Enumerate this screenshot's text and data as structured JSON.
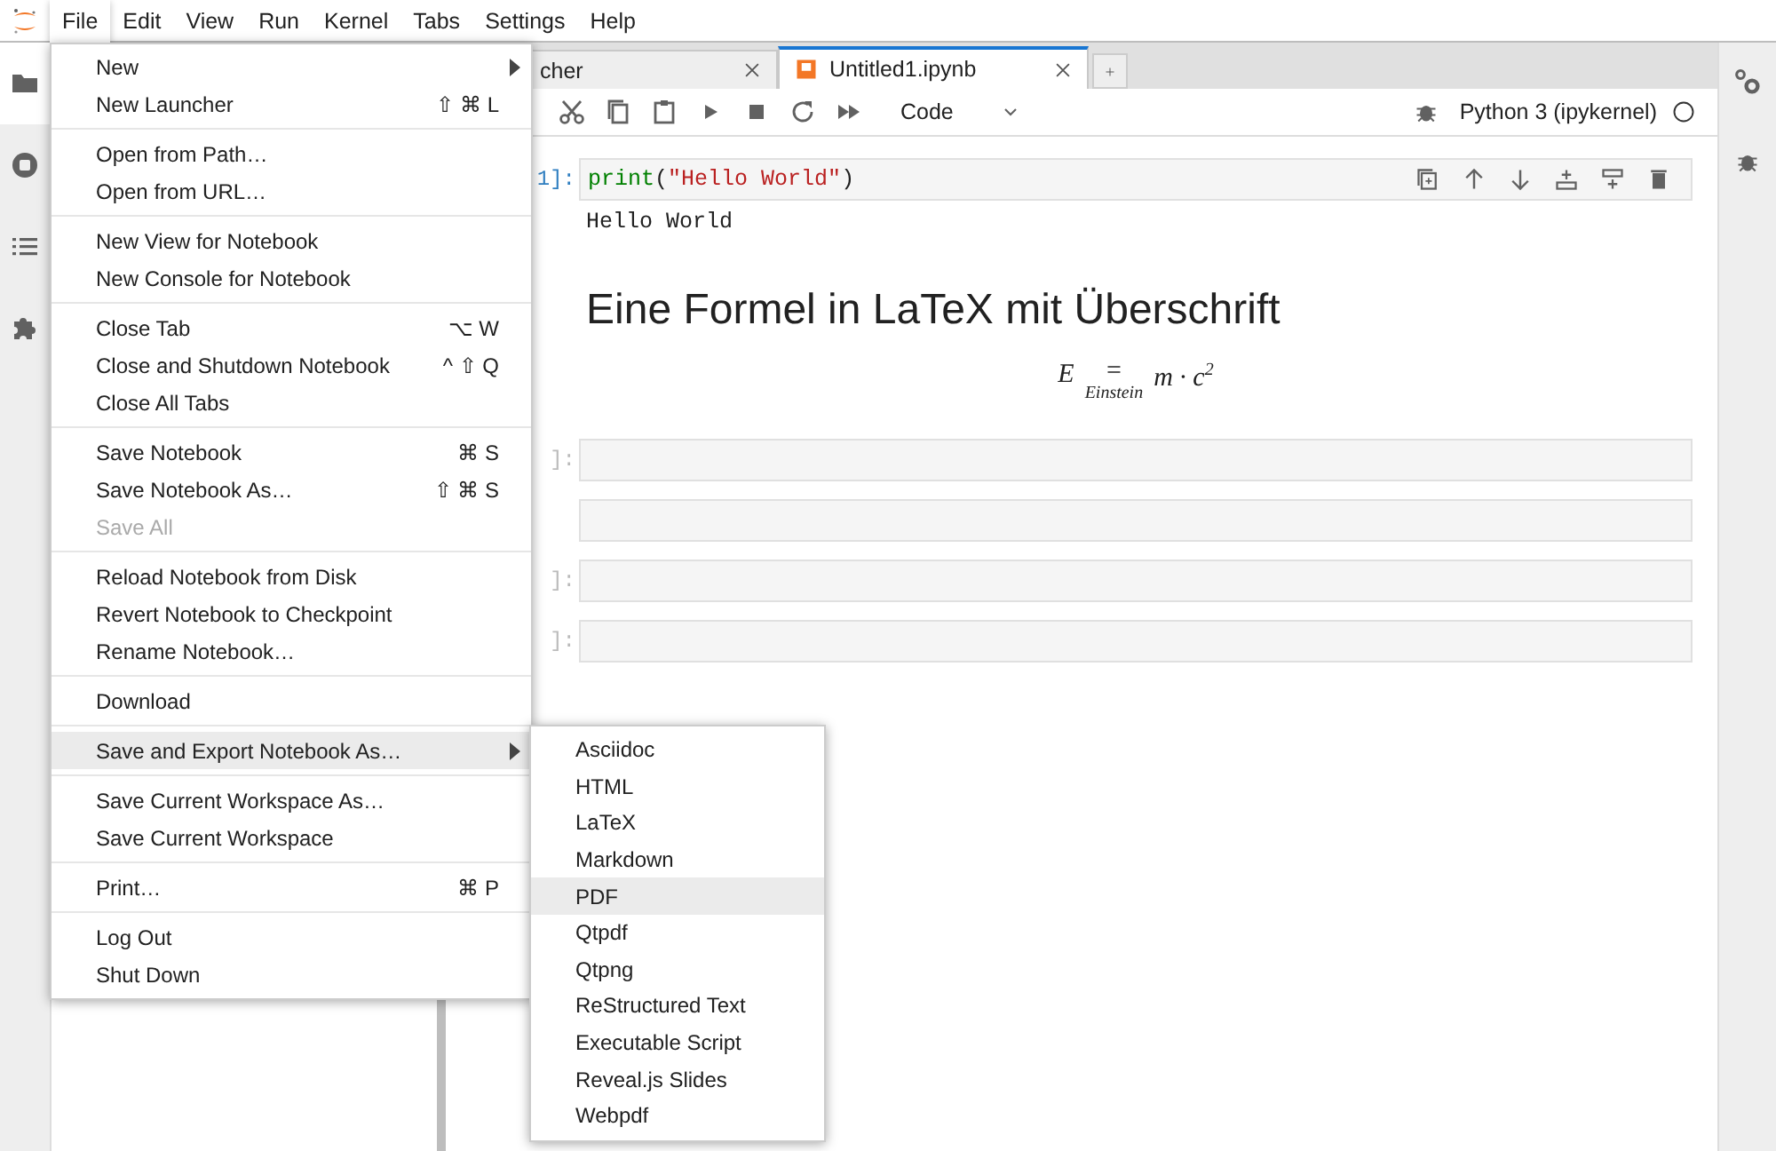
{
  "menubar": {
    "items": [
      {
        "label": "File",
        "selected": true
      },
      {
        "label": "Edit",
        "selected": false
      },
      {
        "label": "View",
        "selected": false
      },
      {
        "label": "Run",
        "selected": false
      },
      {
        "label": "Kernel",
        "selected": false
      },
      {
        "label": "Tabs",
        "selected": false
      },
      {
        "label": "Settings",
        "selected": false
      },
      {
        "label": "Help",
        "selected": false
      }
    ]
  },
  "left_sidebar": {
    "items": [
      {
        "kind": "folder",
        "selected": true
      },
      {
        "kind": "running",
        "selected": false
      },
      {
        "kind": "toc",
        "selected": false
      },
      {
        "kind": "extensions",
        "selected": false
      }
    ]
  },
  "tabs": [
    {
      "label": "cher",
      "selected": false
    },
    {
      "label": "Untitled1.ipynb",
      "selected": true
    }
  ],
  "toolbar": {
    "cell_type": "Code",
    "kernel": "Python 3 (ipykernel)"
  },
  "cells": [
    {
      "kind": "code",
      "active": true,
      "prompt": "1]:",
      "source": [
        {
          "kind": "builtin",
          "text": "print"
        },
        {
          "kind": "punct",
          "text": "("
        },
        {
          "kind": "string",
          "text": "\"Hello World\""
        },
        {
          "kind": "punct",
          "text": ")"
        }
      ],
      "output": "Hello World"
    },
    {
      "kind": "markdown",
      "active": false,
      "heading": "Eine Formel in LaTeX mit Überschrift",
      "formula": {
        "lhs": "E",
        "relation": "=",
        "under": "Einstein",
        "rhs": "m · c",
        "exponent": "2"
      }
    },
    {
      "kind": "code",
      "active": false,
      "prompt": "]:"
    },
    {
      "kind": "code",
      "active": false
    },
    {
      "kind": "code",
      "active": false,
      "prompt": "]:"
    },
    {
      "kind": "code",
      "active": false,
      "prompt": "]:"
    }
  ],
  "file_menu": {
    "sections": [
      {
        "items": [
          {
            "kind": "submenu",
            "label": "New",
            "disabled": false,
            "selected": false
          },
          {
            "kind": "command",
            "label": "New Launcher",
            "shortcut": "⇧ ⌘ L",
            "disabled": false,
            "selected": false
          }
        ]
      },
      {
        "items": [
          {
            "kind": "command",
            "label": "Open from Path…",
            "disabled": false,
            "selected": false
          },
          {
            "kind": "command",
            "label": "Open from URL…",
            "disabled": false,
            "selected": false
          }
        ]
      },
      {
        "items": [
          {
            "kind": "command",
            "label": "New View for Notebook",
            "disabled": false,
            "selected": false
          },
          {
            "kind": "command",
            "label": "New Console for Notebook",
            "disabled": false,
            "selected": false
          }
        ]
      },
      {
        "items": [
          {
            "kind": "command",
            "label": "Close Tab",
            "shortcut": "⌥ W",
            "disabled": false,
            "selected": false
          },
          {
            "kind": "command",
            "label": "Close and Shutdown Notebook",
            "shortcut": "^ ⇧ Q",
            "disabled": false,
            "selected": false
          },
          {
            "kind": "command",
            "label": "Close All Tabs",
            "disabled": false,
            "selected": false
          }
        ]
      },
      {
        "items": [
          {
            "kind": "command",
            "label": "Save Notebook",
            "shortcut": "⌘ S",
            "disabled": false,
            "selected": false
          },
          {
            "kind": "command",
            "label": "Save Notebook As…",
            "shortcut": "⇧ ⌘ S",
            "disabled": false,
            "selected": false
          },
          {
            "kind": "command",
            "label": "Save All",
            "disabled": true,
            "selected": false
          }
        ]
      },
      {
        "items": [
          {
            "kind": "command",
            "label": "Reload Notebook from Disk",
            "disabled": false,
            "selected": false
          },
          {
            "kind": "command",
            "label": "Revert Notebook to Checkpoint",
            "disabled": false,
            "selected": false
          },
          {
            "kind": "command",
            "label": "Rename Notebook…",
            "disabled": false,
            "selected": false
          }
        ]
      },
      {
        "items": [
          {
            "kind": "command",
            "label": "Download",
            "disabled": false,
            "selected": false
          }
        ]
      },
      {
        "items": [
          {
            "kind": "submenu",
            "label": "Save and Export Notebook As…",
            "disabled": false,
            "selected": true
          }
        ]
      },
      {
        "items": [
          {
            "kind": "command",
            "label": "Save Current Workspace As…",
            "disabled": false,
            "selected": false
          },
          {
            "kind": "command",
            "label": "Save Current Workspace",
            "disabled": false,
            "selected": false
          }
        ]
      },
      {
        "items": [
          {
            "kind": "command",
            "label": "Print…",
            "shortcut": "⌘ P",
            "disabled": false,
            "selected": false
          }
        ]
      },
      {
        "items": [
          {
            "kind": "command",
            "label": "Log Out",
            "disabled": false,
            "selected": false
          },
          {
            "kind": "command",
            "label": "Shut Down",
            "disabled": false,
            "selected": false
          }
        ]
      }
    ]
  },
  "export_submenu": {
    "items": [
      {
        "label": "Asciidoc",
        "selected": false
      },
      {
        "label": "HTML",
        "selected": false
      },
      {
        "label": "LaTeX",
        "selected": false
      },
      {
        "label": "Markdown",
        "selected": false
      },
      {
        "label": "PDF",
        "selected": true
      },
      {
        "label": "Qtpdf",
        "selected": false
      },
      {
        "label": "Qtpng",
        "selected": false
      },
      {
        "label": "ReStructured Text",
        "selected": false
      },
      {
        "label": "Executable Script",
        "selected": false
      },
      {
        "label": "Reveal.js Slides",
        "selected": false
      },
      {
        "label": "Webpdf",
        "selected": false
      }
    ]
  }
}
